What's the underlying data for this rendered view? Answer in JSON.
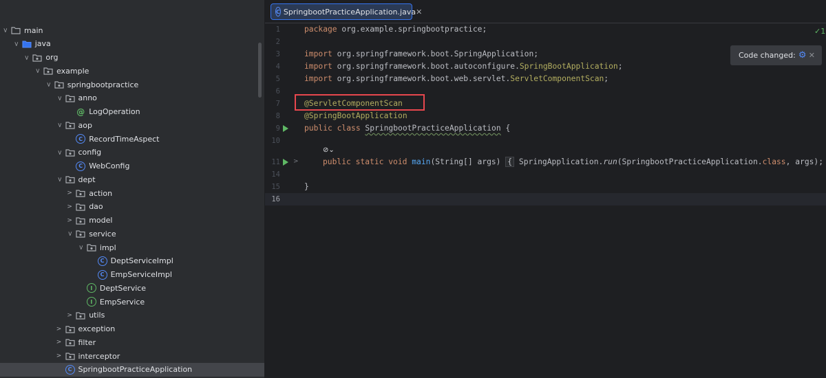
{
  "tree": {
    "items": [
      {
        "label": "main",
        "indent": 0,
        "icon": "folder",
        "open": true
      },
      {
        "label": "java",
        "indent": 1,
        "icon": "source-folder",
        "open": true
      },
      {
        "label": "org",
        "indent": 2,
        "icon": "package",
        "open": true
      },
      {
        "label": "example",
        "indent": 3,
        "icon": "package",
        "open": true
      },
      {
        "label": "springbootpractice",
        "indent": 4,
        "icon": "package",
        "open": true
      },
      {
        "label": "anno",
        "indent": 5,
        "icon": "package",
        "open": true
      },
      {
        "label": "LogOperation",
        "indent": 6,
        "icon": "annotation",
        "leaf": true
      },
      {
        "label": "aop",
        "indent": 5,
        "icon": "package",
        "open": true
      },
      {
        "label": "RecordTimeAspect",
        "indent": 6,
        "icon": "class",
        "leaf": true
      },
      {
        "label": "config",
        "indent": 5,
        "icon": "package",
        "open": true
      },
      {
        "label": "WebConfig",
        "indent": 6,
        "icon": "class",
        "leaf": true
      },
      {
        "label": "dept",
        "indent": 5,
        "icon": "package",
        "open": true
      },
      {
        "label": "action",
        "indent": 6,
        "icon": "package",
        "open": false
      },
      {
        "label": "dao",
        "indent": 6,
        "icon": "package",
        "open": false
      },
      {
        "label": "model",
        "indent": 6,
        "icon": "package",
        "open": false
      },
      {
        "label": "service",
        "indent": 6,
        "icon": "package",
        "open": true
      },
      {
        "label": "impl",
        "indent": 7,
        "icon": "package",
        "open": true
      },
      {
        "label": "DeptServiceImpl",
        "indent": 8,
        "icon": "class",
        "leaf": true
      },
      {
        "label": "EmpServiceImpl",
        "indent": 8,
        "icon": "class",
        "leaf": true
      },
      {
        "label": "DeptService",
        "indent": 7,
        "icon": "interface",
        "leaf": true
      },
      {
        "label": "EmpService",
        "indent": 7,
        "icon": "interface",
        "leaf": true
      },
      {
        "label": "utils",
        "indent": 6,
        "icon": "package",
        "open": false
      },
      {
        "label": "exception",
        "indent": 5,
        "icon": "package",
        "open": false
      },
      {
        "label": "filter",
        "indent": 5,
        "icon": "package",
        "open": false
      },
      {
        "label": "interceptor",
        "indent": 5,
        "icon": "package",
        "open": false
      },
      {
        "label": "SpringbootPracticeApplication",
        "indent": 5,
        "icon": "app-class",
        "leaf": true,
        "selected": true
      }
    ]
  },
  "tab": {
    "label": "SpringbootPracticeApplication.java",
    "icon": "class-icon"
  },
  "editor": {
    "line_numbers": [
      "1",
      "2",
      "3",
      "4",
      "5",
      "6",
      "7",
      "8",
      "9",
      "10",
      "11",
      "14",
      "15",
      "16"
    ],
    "current_line": "16",
    "code": {
      "l1_kw": "package",
      "l1_rest": " org.example.springbootpractice;",
      "l3_kw": "import",
      "l3_rest": " org.springframework.boot.SpringApplication;",
      "l4_kw": "import",
      "l4_pre": " org.springframework.boot.autoconfigure.",
      "l4_ann": "SpringBootApplication",
      "l4_end": ";",
      "l5_kw": "import",
      "l5_pre": " org.springframework.boot.web.servlet.",
      "l5_ann": "ServletComponentScan",
      "l5_end": ";",
      "l7_ann": "@ServletComponentScan",
      "l8_ann": "@SpringBootApplication",
      "l9_kw": "public class ",
      "l9_name": "SpringbootPracticeApplication",
      "l9_end": " {",
      "l11_kw": "public static void ",
      "l11_fn": "main",
      "l11_args": "(String[] args)",
      "l11_open": "{",
      "l11_body_pre": " SpringApplication.",
      "l11_run": "run",
      "l11_body_mid": "(SpringbootPracticeApplication.",
      "l11_class": "class",
      "l11_body_end": ", args); ",
      "l11_close": "}",
      "l15": "}"
    }
  },
  "notification": {
    "label": "Code changed:",
    "icon": "gear-icon",
    "close": "✕"
  },
  "status": {
    "check": "✓1"
  }
}
